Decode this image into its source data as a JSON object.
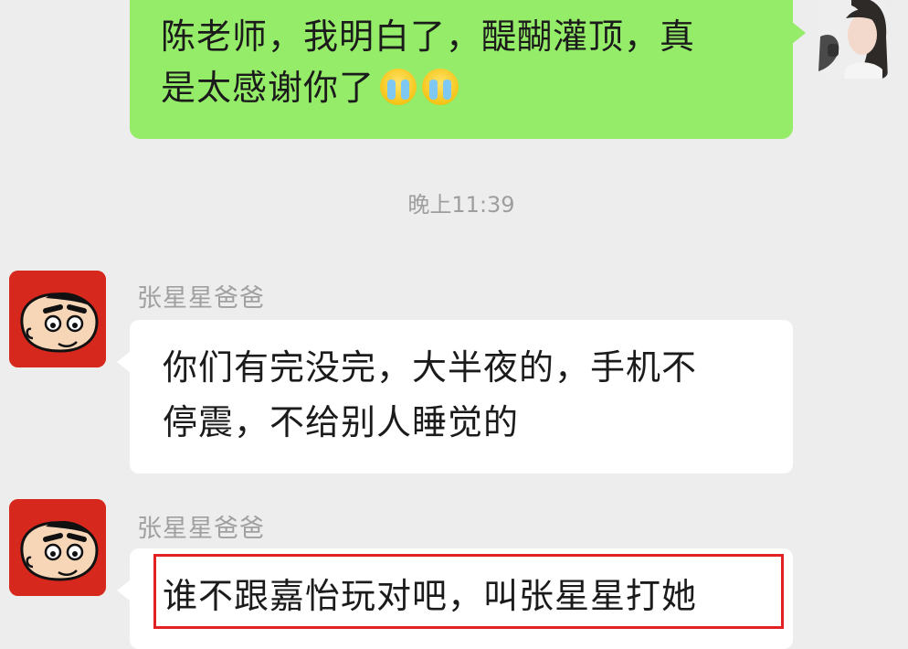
{
  "messages": {
    "outgoing": {
      "text": "陈老师，我明白了，醍醐灌顶，真\n是太感谢你了",
      "emoji": [
        "crying-face-icon",
        "crying-face-icon"
      ]
    },
    "timestamp": "晚上11:39",
    "incoming": [
      {
        "sender": "张星星爸爸",
        "text": "你们有完没完，大半夜的，手机不\n停震，不给别人睡觉的"
      },
      {
        "sender": "张星星爸爸",
        "text": "谁不跟嘉怡玩对吧，叫张星星打她"
      }
    ]
  },
  "colors": {
    "outgoing_bubble": "#95ec69",
    "incoming_bubble": "#ffffff",
    "background": "#ededed",
    "highlight_border": "#e22222",
    "avatar_red": "#d7281e"
  }
}
